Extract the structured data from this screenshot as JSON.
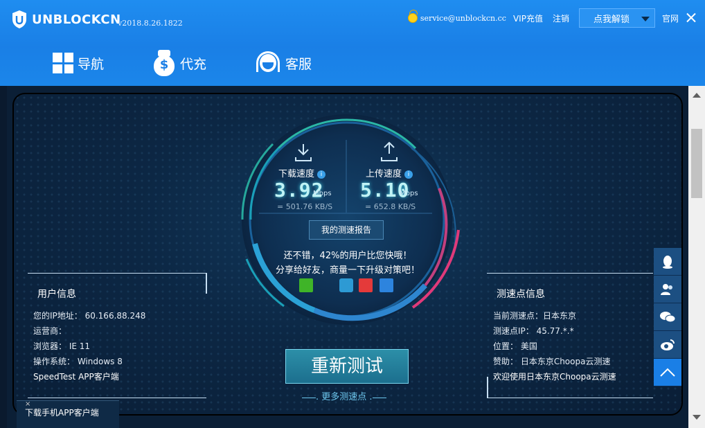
{
  "app": {
    "name": "UNBLOCKCN",
    "version": "v2018.8.26.1822"
  },
  "topbar": {
    "email": "service@unblockcn.cc",
    "vip": "VIP充值",
    "logout": "注销",
    "unlock": "点我解锁",
    "website": "官网"
  },
  "nav": [
    {
      "label": "导航",
      "icon": "grid-icon"
    },
    {
      "label": "代充",
      "icon": "money-bag-icon"
    },
    {
      "label": "客服",
      "icon": "customer-service-icon"
    }
  ],
  "speed": {
    "download_label": "下载速度",
    "download_value": "3.92",
    "download_unit": "Mbps",
    "download_sub": "= 501.76 KB/S",
    "upload_label": "上传速度",
    "upload_value": "5.10",
    "upload_unit": "Mbps",
    "upload_sub": "= 652.8 KB/S",
    "report": "我的测速报告",
    "msg1": "还不错，42%的用户比您快哦！",
    "msg2": "分享给好友，商量一下升级对策吧！"
  },
  "user_info": {
    "title": "用户信息",
    "ip": "您的IP地址：  60.166.88.248",
    "isp": "运营商：",
    "browser": "浏览器：  IE 11",
    "os": "操作系统：  Windows 8",
    "app": "SpeedTest APP客户端"
  },
  "server_info": {
    "title": "测速点信息",
    "node": "当前测速点：日本东京",
    "ip": "测速点IP：  45.77.*.*",
    "location": "位置：  美国",
    "sponsor": "赞助：  日本东京Choopa云测速",
    "welcome": "欢迎使用日本东京Choopa云测速"
  },
  "actions": {
    "retest": "重新测试",
    "more": "更多测速点"
  },
  "download_bar": {
    "label": "下载手机APP客户端",
    "close": "×"
  },
  "colors": {
    "header": "#1a7fe6",
    "accent": "#43d0e6",
    "panel": "#0c2744"
  }
}
